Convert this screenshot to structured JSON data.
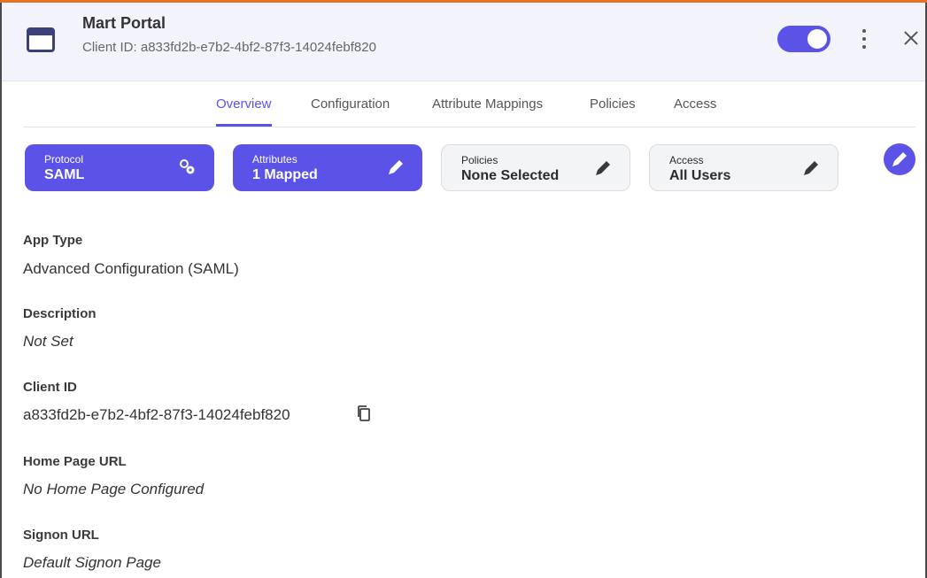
{
  "header": {
    "title": "Mart Portal",
    "client_id_line": "Client ID: a833fd2b-e7b2-4bf2-87f3-14024febf820",
    "app_icon": "app-window-icon",
    "toggle_state": "on",
    "more_icon": "more-vertical-icon",
    "close_icon": "close-icon"
  },
  "tabs": [
    {
      "label": "Overview",
      "active": true
    },
    {
      "label": "Configuration",
      "active": false
    },
    {
      "label": "Attribute Mappings",
      "active": false
    },
    {
      "label": "Policies",
      "active": false
    },
    {
      "label": "Access",
      "active": false
    }
  ],
  "summary": {
    "protocol": {
      "label": "Protocol",
      "value": "SAML",
      "icon": "gears-icon"
    },
    "attributes": {
      "label": "Attributes",
      "value": "1 Mapped",
      "icon": "pencil-icon"
    },
    "policies": {
      "label": "Policies",
      "value": "None Selected",
      "icon": "pencil-icon"
    },
    "access": {
      "label": "Access",
      "value": "All Users",
      "icon": "pencil-icon"
    },
    "edit_icon": "edit-circle-icon"
  },
  "details": {
    "app_type": {
      "label": "App Type",
      "value": "Advanced Configuration (SAML)"
    },
    "description": {
      "label": "Description",
      "value": "Not Set"
    },
    "client_id": {
      "label": "Client ID",
      "value": "a833fd2b-e7b2-4bf2-87f3-14024febf820",
      "copy_icon": "copy-icon"
    },
    "home_page_url": {
      "label": "Home Page URL",
      "value": "No Home Page Configured"
    },
    "signon_url": {
      "label": "Signon URL",
      "value": "Default Signon Page"
    }
  },
  "colors": {
    "accent": "#5b53e8",
    "top_border": "#e37222",
    "header_bg": "#f3f4fb"
  }
}
